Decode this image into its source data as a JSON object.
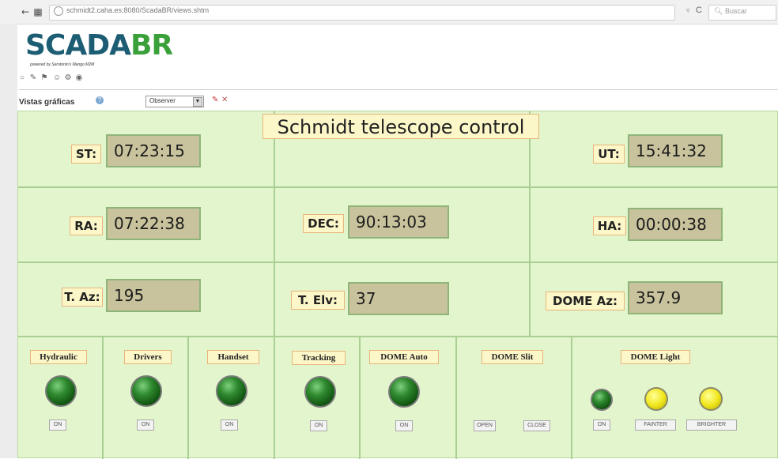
{
  "browser": {
    "back_icon": "back-arrow-icon",
    "url": "schmidt2.caha.es:8080/ScadaBR/views.shtm",
    "search_placeholder": "Buscar"
  },
  "app": {
    "logo_part1": "SCADA",
    "logo_part2": "BR",
    "tagline": "powered by Serotonin's Mango M2M",
    "views_label": "Vistas gráficas",
    "selected_view": "Observer",
    "colors": {
      "panel_bg": "#e3f5cc",
      "label_bg": "#fcf7c8",
      "value_bg": "#c8c39c",
      "logo_blue": "#1c5d73",
      "logo_green": "#3aa13a"
    }
  },
  "panel": {
    "title": "Schmidt telescope control",
    "readouts": {
      "st": {
        "label": "ST:",
        "value": "07:23:15"
      },
      "ut": {
        "label": "UT:",
        "value": "15:41:32"
      },
      "ra": {
        "label": "RA:",
        "value": "07:22:38"
      },
      "dec": {
        "label": "DEC:",
        "value": "90:13:03"
      },
      "ha": {
        "label": "HA:",
        "value": "00:00:38"
      },
      "taz": {
        "label": "T. Az:",
        "value": "195"
      },
      "telv": {
        "label": "T. Elv:",
        "value": "37"
      },
      "domeaz": {
        "label": "DOME Az:",
        "value": "357.9"
      }
    },
    "switches": {
      "hydraulic": {
        "label": "Hydraulic",
        "button": "ON"
      },
      "drivers": {
        "label": "Drivers",
        "button": "ON"
      },
      "handset": {
        "label": "Handset",
        "button": "ON"
      },
      "tracking": {
        "label": "Tracking",
        "button": "ON"
      },
      "dome_auto": {
        "label": "DOME Auto",
        "button": "ON"
      },
      "dome_slit": {
        "label": "DOME Slit",
        "open": "OPEN",
        "close": "CLOSE"
      },
      "dome_light": {
        "label": "DOME Light",
        "on": "ON",
        "fainter": "FAINTER",
        "brighter": "BRIGHTER"
      }
    }
  }
}
